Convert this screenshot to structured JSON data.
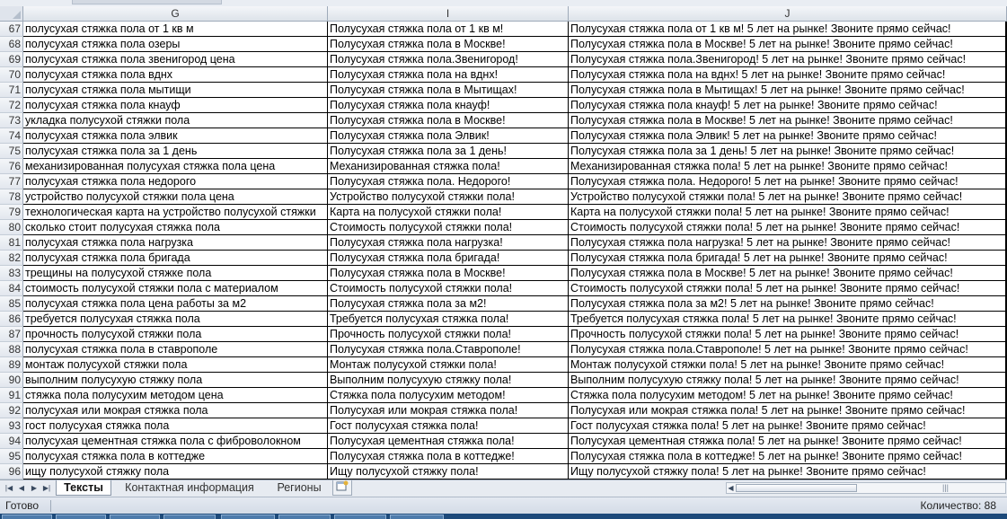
{
  "columns": [
    {
      "key": "g",
      "label": "G"
    },
    {
      "key": "i",
      "label": "I"
    },
    {
      "key": "j",
      "label": "J"
    }
  ],
  "rows": [
    {
      "n": "67",
      "g": "полусухая стяжка пола от 1 кв м",
      "i": "Полусухая стяжка пола от 1 кв м!",
      "j": "Полусухая стяжка пола от 1 кв м! 5 лет на рынке! Звоните прямо сейчас!"
    },
    {
      "n": "68",
      "g": "полусухая стяжка пола озеры",
      "i": "Полусухая стяжка пола в Москве!",
      "j": "Полусухая стяжка пола в Москве! 5 лет на рынке! Звоните прямо сейчас!"
    },
    {
      "n": "69",
      "g": "полусухая стяжка пола звенигород цена",
      "i": "Полусухая стяжка пола.Звенигород!",
      "j": "Полусухая стяжка пола.Звенигород! 5 лет на рынке! Звоните прямо сейчас!"
    },
    {
      "n": "70",
      "g": "полусухая стяжка пола вднх",
      "i": "Полусухая стяжка пола на вднх!",
      "j": "Полусухая стяжка пола на вднх! 5 лет на рынке! Звоните прямо сейчас!"
    },
    {
      "n": "71",
      "g": "полусухая стяжка пола мытищи",
      "i": "Полусухая стяжка пола в Мытищах!",
      "j": "Полусухая стяжка пола в Мытищах! 5 лет на рынке! Звоните прямо сейчас!"
    },
    {
      "n": "72",
      "g": "полусухая стяжка пола кнауф",
      "i": "Полусухая стяжка пола кнауф!",
      "j": "Полусухая стяжка пола кнауф! 5 лет на рынке! Звоните прямо сейчас!"
    },
    {
      "n": "73",
      "g": "укладка полусухой стяжки пола",
      "i": "Полусухая стяжка пола в Москве!",
      "j": "Полусухая стяжка пола в Москве! 5 лет на рынке! Звоните прямо сейчас!"
    },
    {
      "n": "74",
      "g": "полусухая стяжка пола элвик",
      "i": "Полусухая стяжка пола Элвик!",
      "j": "Полусухая стяжка пола Элвик! 5 лет на рынке! Звоните прямо сейчас!"
    },
    {
      "n": "75",
      "g": "полусухая стяжка пола за 1 день",
      "i": "Полусухая стяжка пола за 1 день!",
      "j": "Полусухая стяжка пола за 1 день! 5 лет на рынке! Звоните прямо сейчас!"
    },
    {
      "n": "76",
      "g": "механизированная полусухая стяжка пола цена",
      "i": "Механизированная стяжка пола!",
      "j": "Механизированная стяжка пола! 5 лет на рынке! Звоните прямо сейчас!"
    },
    {
      "n": "77",
      "g": "полусухая стяжка пола недорого",
      "i": "Полусухая стяжка пола. Недорого!",
      "j": "Полусухая стяжка пола. Недорого! 5 лет на рынке! Звоните прямо сейчас!"
    },
    {
      "n": "78",
      "g": "устройство полусухой стяжки пола цена",
      "i": "Устройство полусухой стяжки пола!",
      "j": "Устройство полусухой стяжки пола! 5 лет на рынке! Звоните прямо сейчас!"
    },
    {
      "n": "79",
      "g": "технологическая карта на устройство полусухой стяжки",
      "i": "Карта на полусухой стяжки пола!",
      "j": "Карта на полусухой стяжки пола! 5 лет на рынке! Звоните прямо сейчас!"
    },
    {
      "n": "80",
      "g": "сколько стоит полусухая стяжка пола",
      "i": "Стоимость полусухой стяжки пола!",
      "j": "Стоимость полусухой стяжки пола! 5 лет на рынке! Звоните прямо сейчас!"
    },
    {
      "n": "81",
      "g": "полусухая стяжка пола нагрузка",
      "i": "Полусухая стяжка пола нагрузка!",
      "j": "Полусухая стяжка пола нагрузка! 5 лет на рынке! Звоните прямо сейчас!"
    },
    {
      "n": "82",
      "g": "полусухая стяжка пола бригада",
      "i": "Полусухая стяжка пола бригада!",
      "j": "Полусухая стяжка пола бригада! 5 лет на рынке! Звоните прямо сейчас!"
    },
    {
      "n": "83",
      "g": "трещины на полусухой стяжке пола",
      "i": "Полусухая стяжка пола в Москве!",
      "j": "Полусухая стяжка пола в Москве! 5 лет на рынке! Звоните прямо сейчас!"
    },
    {
      "n": "84",
      "g": "стоимость полусухой стяжки пола с материалом",
      "i": "Стоимость полусухой стяжки пола!",
      "j": "Стоимость полусухой стяжки пола! 5 лет на рынке! Звоните прямо сейчас!"
    },
    {
      "n": "85",
      "g": "полусухая стяжка пола цена работы за м2",
      "i": "Полусухая стяжка пола за м2!",
      "j": "Полусухая стяжка пола за м2! 5 лет на рынке! Звоните прямо сейчас!"
    },
    {
      "n": "86",
      "g": "требуется полусухая стяжка пола",
      "i": "Требуется полусухая стяжка пола!",
      "j": "Требуется полусухая стяжка пола! 5 лет на рынке! Звоните прямо сейчас!"
    },
    {
      "n": "87",
      "g": "прочность полусухой стяжки пола",
      "i": "Прочность полусухой стяжки пола!",
      "j": "Прочность полусухой стяжки пола! 5 лет на рынке! Звоните прямо сейчас!"
    },
    {
      "n": "88",
      "g": "полусухая стяжка пола в ставрополе",
      "i": "Полусухая стяжка пола.Ставрополе!",
      "j": "Полусухая стяжка пола.Ставрополе! 5 лет на рынке! Звоните прямо сейчас!"
    },
    {
      "n": "89",
      "g": "монтаж полусухой стяжки пола",
      "i": "Монтаж полусухой стяжки пола!",
      "j": "Монтаж полусухой стяжки пола! 5 лет на рынке! Звоните прямо сейчас!"
    },
    {
      "n": "90",
      "g": "выполним полусухую стяжку пола",
      "i": "Выполним полусухую стяжку пола!",
      "j": "Выполним полусухую стяжку пола! 5 лет на рынке! Звоните прямо сейчас!"
    },
    {
      "n": "91",
      "g": "стяжка пола полусухим методом цена",
      "i": "Стяжка пола полусухим методом!",
      "j": "Стяжка пола полусухим методом! 5 лет на рынке! Звоните прямо сейчас!"
    },
    {
      "n": "92",
      "g": "полусухая или мокрая стяжка пола",
      "i": "Полусухая или мокрая стяжка пола!",
      "j": "Полусухая или мокрая стяжка пола! 5 лет на рынке! Звоните прямо сейчас!"
    },
    {
      "n": "93",
      "g": "гост полусухая стяжка пола",
      "i": "Гост полусухая стяжка пола!",
      "j": "Гост полусухая стяжка пола! 5 лет на рынке! Звоните прямо сейчас!"
    },
    {
      "n": "94",
      "g": "полусухая цементная стяжка пола с фиброволокном",
      "i": "Полусухая цементная стяжка пола!",
      "j": "Полусухая цементная стяжка пола! 5 лет на рынке! Звоните прямо сейчас!"
    },
    {
      "n": "95",
      "g": "полусухая стяжка пола в коттедже",
      "i": "Полусухая стяжка пола в коттедже!",
      "j": "Полусухая стяжка пола в коттедже! 5 лет на рынке! Звоните прямо сейчас!"
    },
    {
      "n": "96",
      "g": "ищу полусухой стяжку пола",
      "i": "Ищу полусухой стяжку пола!",
      "j": "Ищу полусухой стяжку пола! 5 лет на рынке! Звоните прямо сейчас!"
    }
  ],
  "sheet_tabs": {
    "nav_icons": [
      "first-sheet-icon",
      "prev-sheet-icon",
      "next-sheet-icon",
      "last-sheet-icon"
    ],
    "tabs": [
      {
        "label": "Тексты",
        "active": true
      },
      {
        "label": "Контактная информация",
        "active": false
      },
      {
        "label": "Регионы",
        "active": false
      }
    ],
    "insert_icon": "insert-sheet-icon"
  },
  "status": {
    "ready": "Готово",
    "count": "Количество: 88"
  },
  "colors": {
    "grid_line": "#000000",
    "header_bg": "#dde3ea",
    "status_bg": "#d3dbe6",
    "taskbar": "#1d4a7a"
  }
}
